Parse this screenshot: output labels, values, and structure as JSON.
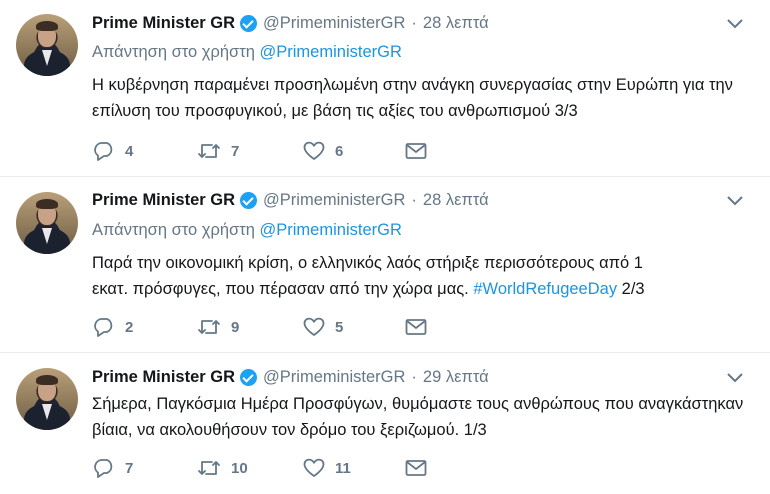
{
  "tweets": [
    {
      "name": "Prime Minister GR",
      "handle": "@PrimeministerGR",
      "separator": "·",
      "time": "28 λεπτά",
      "reply_prefix": "Απάντηση στο χρήστη",
      "reply_mention": "@PrimeministerGR",
      "text": "Η κυβέρνηση παραμένει προσηλωμένη στην ανάγκη συνεργασίας στην Ευρώπη για την επίλυση του προσφυγικού, με βάση τις αξίες του ανθρωπισμού 3/3",
      "replies": "4",
      "retweets": "7",
      "likes": "6"
    },
    {
      "name": "Prime Minister GR",
      "handle": "@PrimeministerGR",
      "separator": "·",
      "time": "28 λεπτά",
      "reply_prefix": "Απάντηση στο χρήστη",
      "reply_mention": "@PrimeministerGR",
      "text_line1": "Παρά την οικονομική κρίση, ο ελληνικός λαός στήριξε περισσότερους από 1",
      "text_line2": "εκατ. πρόσφυγες, που πέρασαν από την χώρα μας.",
      "hashtag": "#WorldRefugeeDay",
      "text_suffix": "2/3",
      "replies": "2",
      "retweets": "9",
      "likes": "5"
    },
    {
      "name": "Prime Minister GR",
      "handle": "@PrimeministerGR",
      "separator": "·",
      "time": "29 λεπτά",
      "text": "Σήμερα, Παγκόσμια Ημέρα Προσφύγων, θυμόμαστε τους ανθρώπους που αναγκάστηκαν βίαια, να ακολουθήσουν τον δρόμο του ξεριζωμού. 1/3",
      "replies": "7",
      "retweets": "10",
      "likes": "11"
    }
  ],
  "icons": {
    "reply": "reply-icon",
    "retweet": "retweet-icon",
    "like": "heart-icon",
    "dm": "envelope-icon",
    "caret": "chevron-down-icon",
    "verified": "verified-badge-icon"
  },
  "colors": {
    "link": "#1b95e0",
    "muted": "#657786",
    "verified": "#1da1f2",
    "divider": "#e6ecf0"
  }
}
